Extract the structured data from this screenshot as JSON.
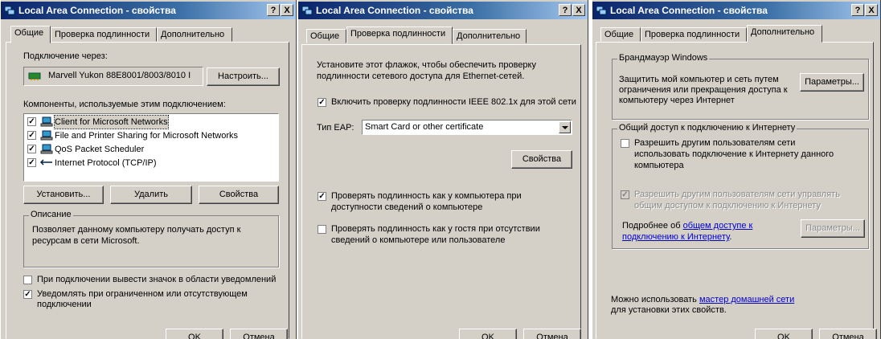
{
  "windows": [
    {
      "title": "Local Area Connection - свойства",
      "help_label": "?",
      "close_label": "X",
      "tabs": [
        "Общие",
        "Проверка подлинности",
        "Дополнительно"
      ],
      "active_tab": 0,
      "connect_via_label": "Подключение через:",
      "adapter_name": "Marvell Yukon 88E8001/8003/8010 I",
      "configure_button": "Настроить...",
      "components_label": "Компоненты, используемые этим подключением:",
      "components": [
        {
          "label": "Client for Microsoft Networks",
          "checked": true,
          "selected": true
        },
        {
          "label": "File and Printer Sharing for Microsoft Networks",
          "checked": true
        },
        {
          "label": "QoS Packet Scheduler",
          "checked": true
        },
        {
          "label": "Internet Protocol (TCP/IP)",
          "checked": true
        }
      ],
      "install_button": "Установить...",
      "uninstall_button": "Удалить",
      "properties_button": "Свойства",
      "description_title": "Описание",
      "description_line1": "Позволяет данному компьютеру получать доступ к",
      "description_line2": "ресурсам в сети Microsoft.",
      "show_icon_label": "При подключении вывести значок в области уведомлений",
      "show_icon_checked": false,
      "notify_label_line1": "Уведомлять при ограниченном или отсутствующем",
      "notify_label_line2": "подключении",
      "notify_checked": true,
      "ok_button": "OK",
      "cancel_button": "Отмена"
    },
    {
      "title": "Local Area Connection - свойства",
      "help_label": "?",
      "close_label": "X",
      "tabs": [
        "Общие",
        "Проверка подлинности",
        "Дополнительно"
      ],
      "active_tab": 1,
      "intro_line1": "Установите этот флажок, чтобы обеспечить проверку",
      "intro_line2": "подлинности сетевого доступа для Ethernet-сетей.",
      "enable_ieee_label": "Включить проверку подлинности IEEE 802.1x для этой сети",
      "enable_ieee_checked": true,
      "eap_type_label": "Тип EAP:",
      "eap_type_value": "Smart Card or other certificate",
      "properties_button": "Свойства",
      "auth_computer_line1": "Проверять подлинность как у компьютера при",
      "auth_computer_line2": "доступности сведений о компьютере",
      "auth_computer_checked": true,
      "auth_guest_line1": "Проверять подлинность как у гостя при отсутствии",
      "auth_guest_line2": "сведений о компьютере или пользователе",
      "auth_guest_checked": false,
      "ok_button": "OK",
      "cancel_button": "Отмена"
    },
    {
      "title": "Local Area Connection - свойства",
      "help_label": "?",
      "close_label": "X",
      "tabs": [
        "Общие",
        "Проверка подлинности",
        "Дополнительно"
      ],
      "active_tab": 2,
      "firewall_title": "Брандмауэр Windows",
      "firewall_text_line1": "Защитить мой компьютер и сеть путем",
      "firewall_text_line2": "ограничения или прекращения доступа к",
      "firewall_text_line3": "компьютеру через Интернет",
      "firewall_settings_button": "Параметры...",
      "ics_title": "Общий доступ к подключению к Интернету",
      "ics_allow_line1": "Разрешить другим пользователям сети",
      "ics_allow_line2": "использовать подключение к Интернету данного",
      "ics_allow_line3": "компьютера",
      "ics_allow_checked": false,
      "ics_control_line1": "Разрешить другим пользователям сети управлять",
      "ics_control_line2": "общим доступом к подключению к Интернету",
      "ics_control_checked": true,
      "more_info_prefix": "Подробнее об ",
      "more_info_link1": "общем доступе к",
      "more_info_link2": "подключению к Интернету",
      "more_info_suffix": ".",
      "ics_settings_button": "Параметры...",
      "wizard_prefix": "Можно использовать ",
      "wizard_link": "мастер домашней сети",
      "wizard_suffix": "для установки этих свойств.",
      "ok_button": "OK",
      "cancel_button": "Отмена"
    }
  ],
  "colors": {
    "title_active": "#0a246a",
    "title_gradient_end": "#a6caf0",
    "face": "#d4d0c8",
    "link": "#0000cc"
  }
}
